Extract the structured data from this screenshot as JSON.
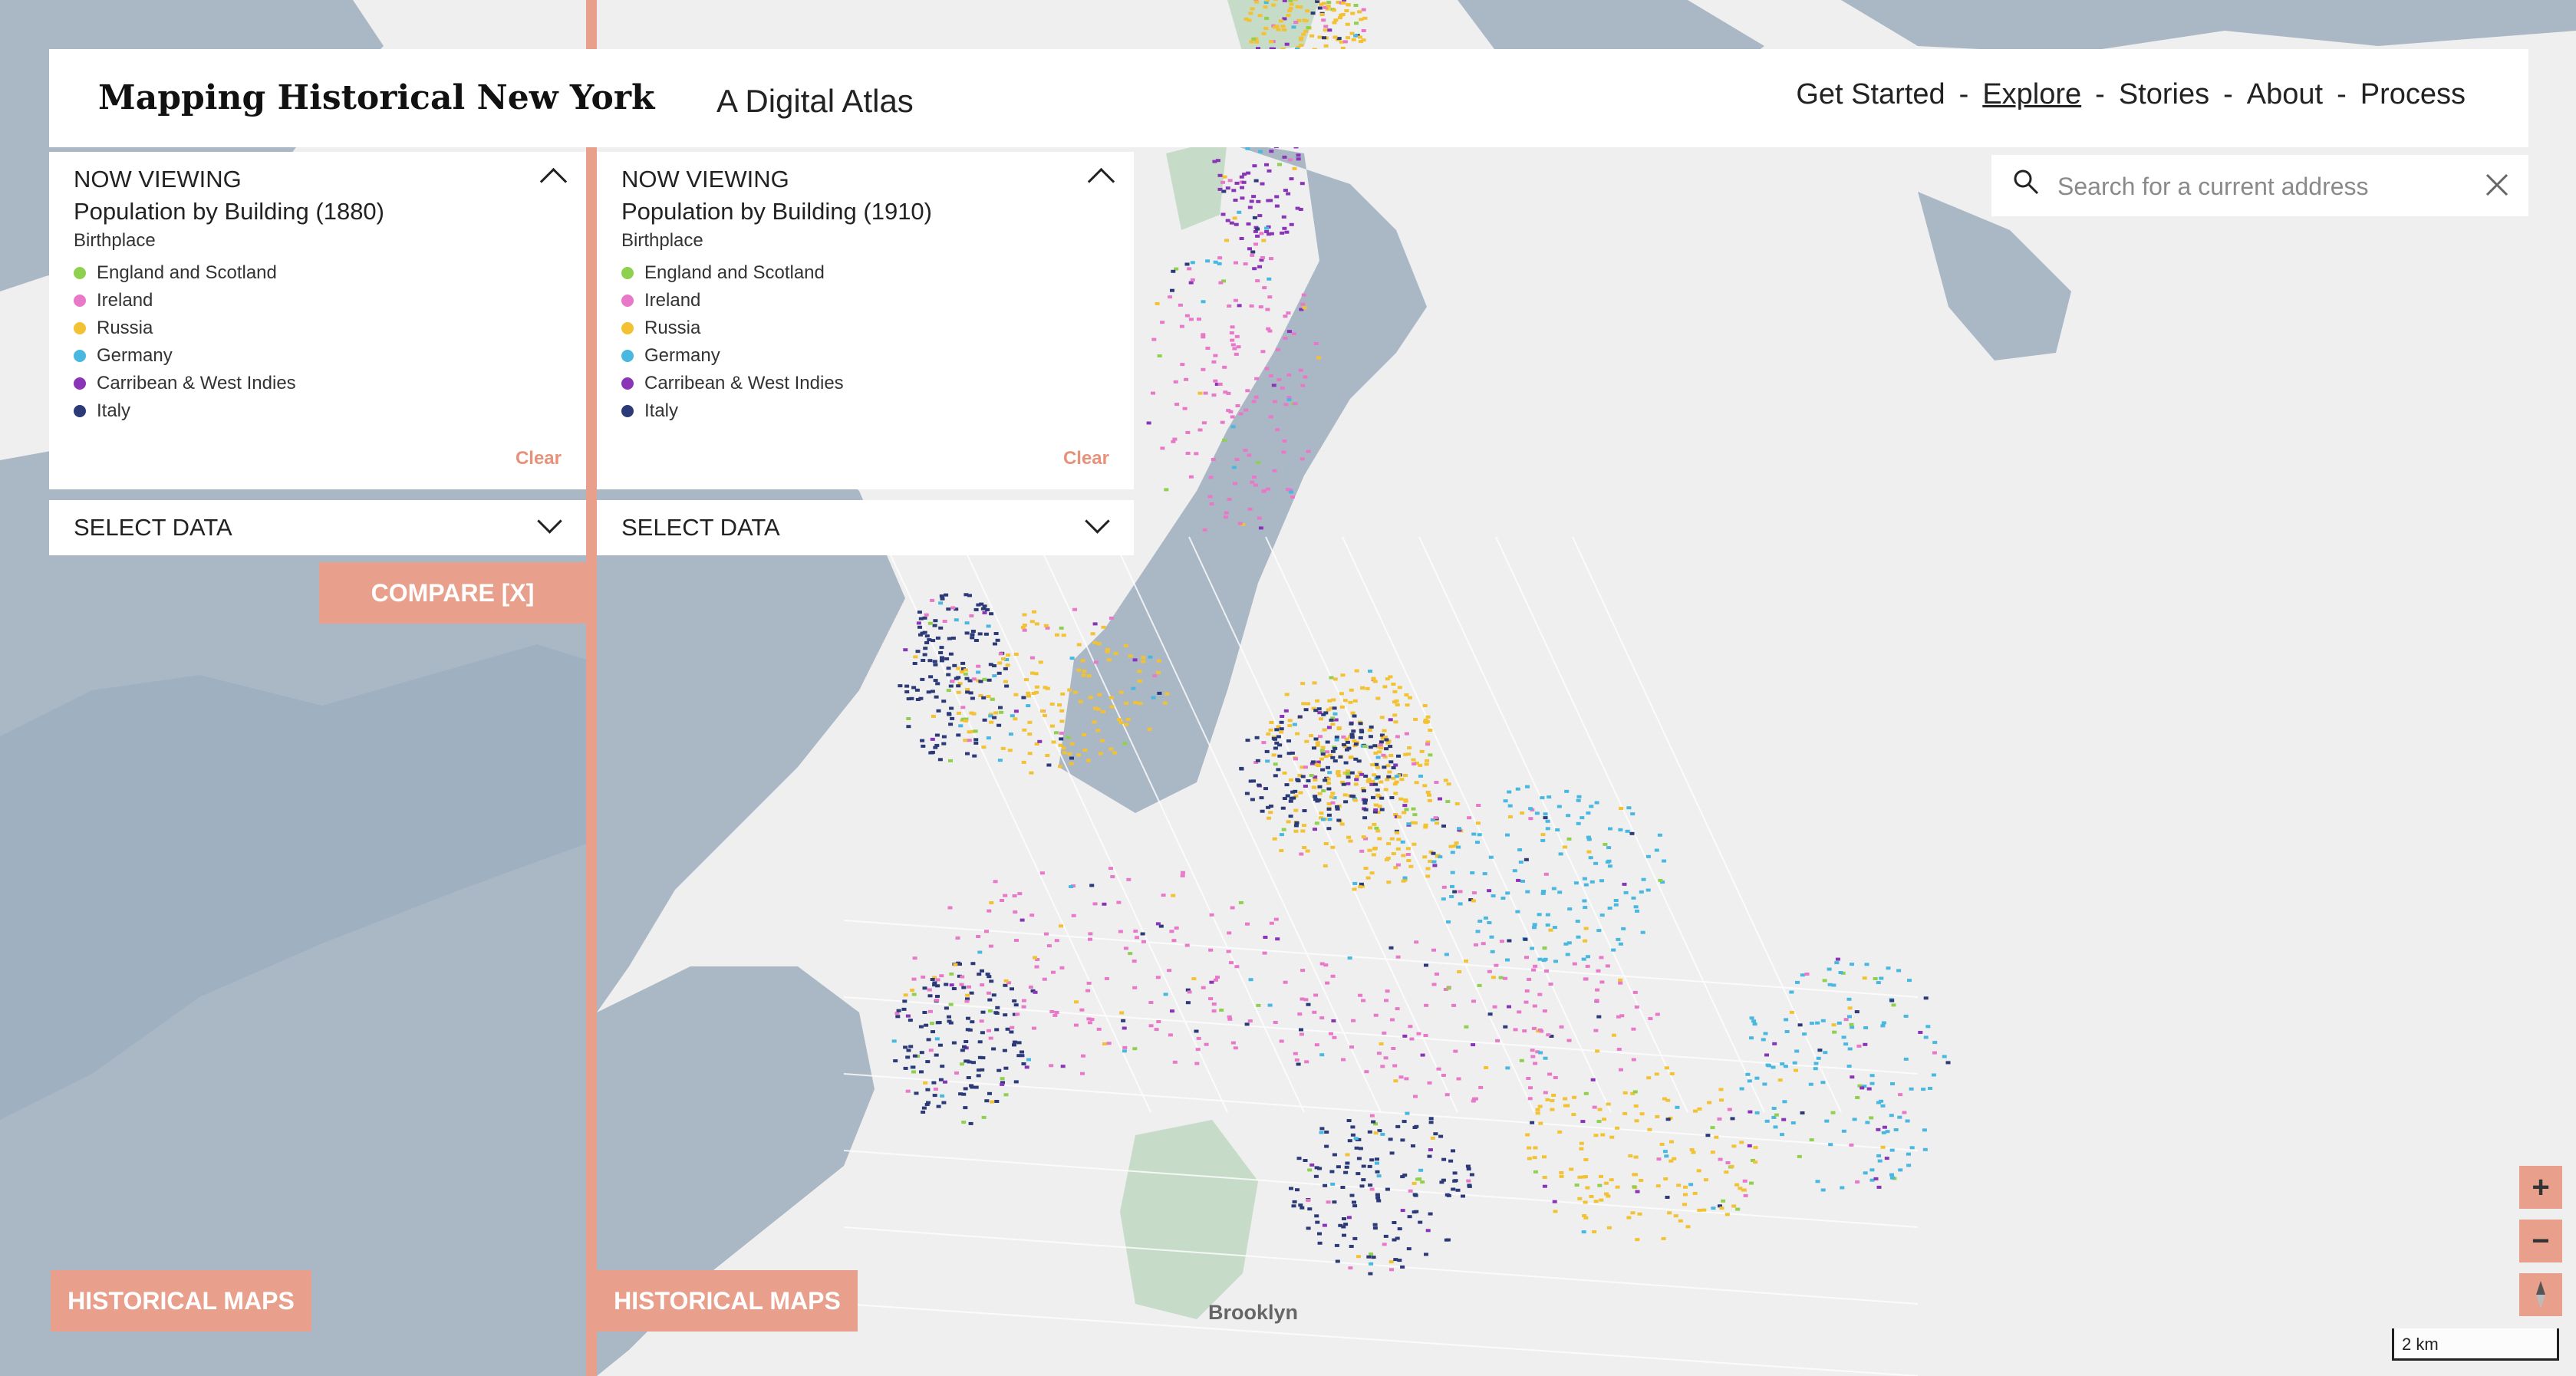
{
  "header": {
    "title": "Mapping Historical New York",
    "subtitle": "A Digital Atlas",
    "nav": [
      "Get Started",
      "Explore",
      "Stories",
      "About",
      "Process"
    ],
    "separator": "-",
    "active_nav": "Explore"
  },
  "left_panel": {
    "now_viewing": "NOW VIEWING",
    "layer": "Population by Building (1880)",
    "legend_title": "Birthplace",
    "legend": [
      {
        "label": "England and Scotland",
        "color": "#8fd14f"
      },
      {
        "label": "Ireland",
        "color": "#e879c8"
      },
      {
        "label": "Russia",
        "color": "#f2c233"
      },
      {
        "label": "Germany",
        "color": "#48b8e0"
      },
      {
        "label": "Carribean & West Indies",
        "color": "#8a35b8"
      },
      {
        "label": "Italy",
        "color": "#2c3a78"
      }
    ],
    "clear": "Clear",
    "select": "SELECT DATA"
  },
  "right_panel": {
    "now_viewing": "NOW VIEWING",
    "layer": "Population by Building (1910)",
    "legend_title": "Birthplace",
    "legend": [
      {
        "label": "England and Scotland",
        "color": "#8fd14f"
      },
      {
        "label": "Ireland",
        "color": "#e879c8"
      },
      {
        "label": "Russia",
        "color": "#f2c233"
      },
      {
        "label": "Germany",
        "color": "#48b8e0"
      },
      {
        "label": "Carribean & West Indies",
        "color": "#8a35b8"
      },
      {
        "label": "Italy",
        "color": "#2c3a78"
      }
    ],
    "clear": "Clear",
    "select": "SELECT DATA"
  },
  "compare": "COMPARE [X]",
  "historical_maps_left": "HISTORICAL MAPS",
  "historical_maps_right": "HISTORICAL MAPS",
  "search": {
    "placeholder": "Search for a current address"
  },
  "zoom": {
    "in": "+",
    "out": "−"
  },
  "scale_label": "2 km",
  "place_label": "Brooklyn",
  "colors": {
    "accent": "#e8a08c",
    "water": "#aab8c6",
    "land": "#efefef",
    "park": "#c6dcc8"
  },
  "icons": [
    "search-icon",
    "close-icon",
    "chevron-up-icon",
    "chevron-down-icon",
    "compass-icon"
  ]
}
